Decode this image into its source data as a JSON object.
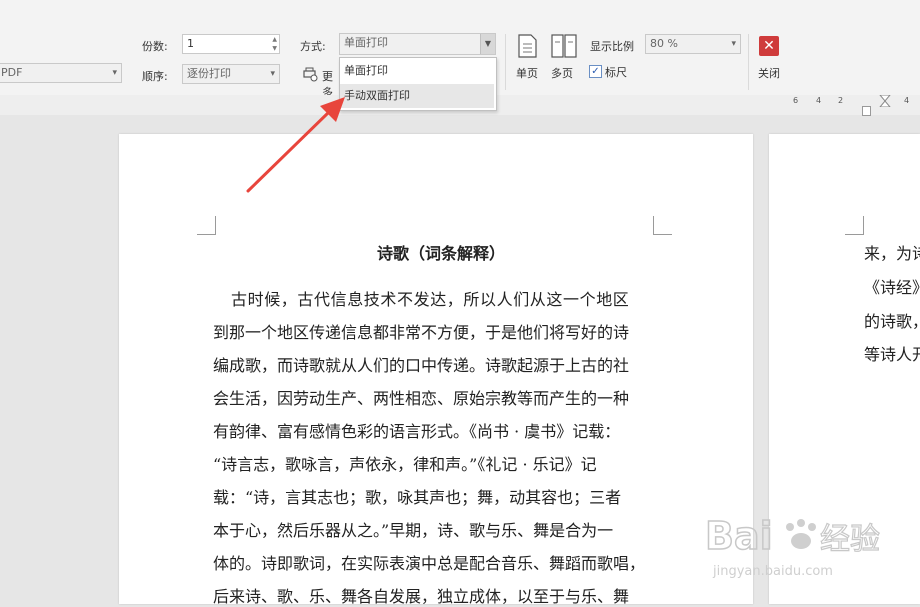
{
  "toolbar": {
    "copies_label": "份数:",
    "copies_value": "1",
    "mode_label": "方式:",
    "mode_value": "单面打印",
    "order_label": "顺序:",
    "order_value": "逐份打印",
    "printer_value": "PDF",
    "more_label": "更多",
    "single_page_label": "单页",
    "multi_page_label": "多页",
    "zoom_label": "显示比例",
    "zoom_value": "80 %",
    "ruler_checkbox_label": "标尺",
    "ruler_checked": true,
    "close_label": "关闭"
  },
  "dropdown": {
    "options": [
      "单面打印",
      "手动双面打印"
    ],
    "highlighted_index": 1
  },
  "ruler": {
    "ticks": [
      "6",
      "4",
      "2",
      "4"
    ]
  },
  "document": {
    "title": "诗歌（词条解释）",
    "lines": [
      "古时候，古代信息技术不发达，所以人们从这一个地区",
      "到那一个地区传递信息都非常不方便，于是他们将写好的诗",
      "编成歌，而诗歌就从人们的口中传递。诗歌起源于上古的社",
      "会生活，因劳动生产、两性相恋、原始宗教等而产生的一种",
      "有韵律、富有感情色彩的语言形式。《尚书 · 虞书》记载：",
      "“诗言志，歌咏言，声依永，律和声。”《礼记 · 乐记》记",
      "载：“诗，言其志也；歌，咏其声也；舞，动其容也；三者",
      "本于心，然后乐器从之。”早期，诗、歌与乐、舞是合为一",
      "体的。诗即歌词，在实际表演中总是配合音乐、舞蹈而歌唱，",
      "后来诗、歌、乐、舞各自发展，独立成体，以至于与乐、舞"
    ],
    "next_page_lines": [
      "来，为诗",
      "《诗经》",
      "的诗歌，",
      "等诗人开"
    ]
  },
  "watermark": {
    "brand": "Baidu经验",
    "url": "jingyan.baidu.com"
  },
  "colors": {
    "arrow": "#e8453c",
    "close_bg": "#cf3b3b",
    "highlight": "#e7e7e7"
  }
}
